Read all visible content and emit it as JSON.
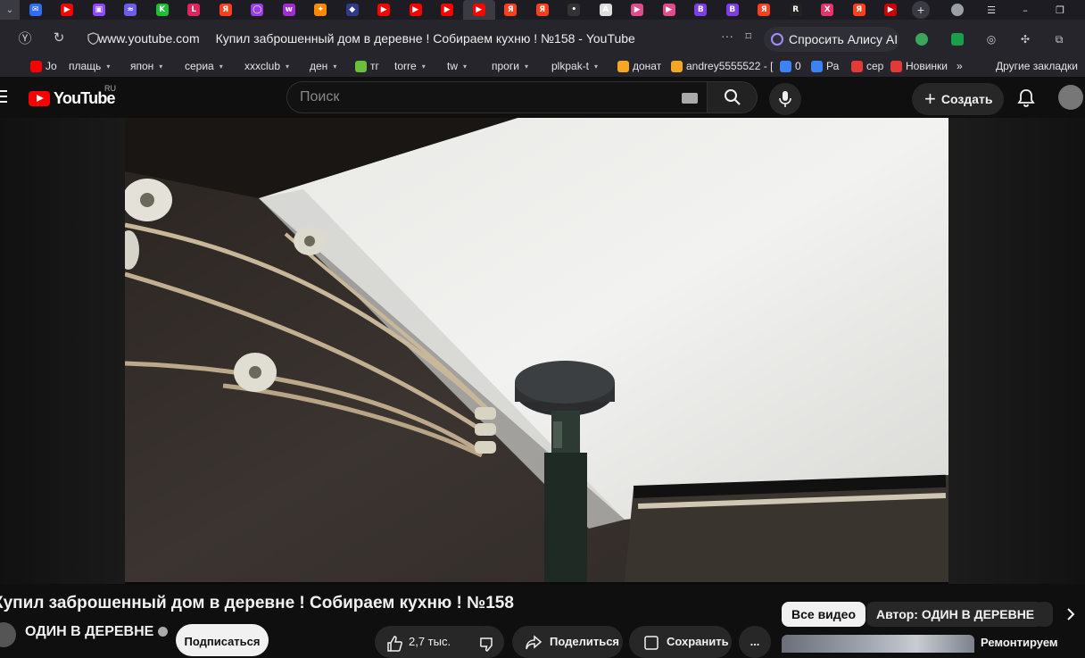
{
  "browser": {
    "tabs": [
      {
        "icon": "mail-icon",
        "color": "#2f6df6",
        "glyph": "✉"
      },
      {
        "icon": "youtube-icon",
        "color": "#ff0000",
        "glyph": "▶"
      },
      {
        "icon": "twitch-icon",
        "color": "#9146ff",
        "glyph": "▣"
      },
      {
        "icon": "generic-site-icon",
        "color": "#6c5ce7",
        "glyph": "≈"
      },
      {
        "icon": "kick-icon",
        "color": "#1dbf30",
        "glyph": "K"
      },
      {
        "icon": "live-icon",
        "color": "#e0245e",
        "glyph": "L"
      },
      {
        "icon": "yandex-icon",
        "color": "#fc3f1d",
        "glyph": "Я"
      },
      {
        "icon": "ring-site-icon",
        "color": "#9b3cf5",
        "glyph": "◯"
      },
      {
        "icon": "wildberries-icon",
        "color": "#a22bd6",
        "glyph": "w"
      },
      {
        "icon": "fire-icon",
        "color": "#ff8a00",
        "glyph": "✦"
      },
      {
        "icon": "dark-site-icon",
        "color": "#2e3b8a",
        "glyph": "◆"
      },
      {
        "icon": "youtube-icon",
        "color": "#ff0000",
        "glyph": "▶"
      },
      {
        "icon": "youtube-icon",
        "color": "#ff0000",
        "glyph": "▶"
      },
      {
        "icon": "youtube-icon",
        "color": "#ff0000",
        "glyph": "▶"
      },
      {
        "icon": "youtube-icon",
        "color": "#ff0000",
        "glyph": "▶",
        "active": true
      },
      {
        "icon": "yandex-icon",
        "color": "#fc3f1d",
        "glyph": "Я"
      },
      {
        "icon": "yandex-icon",
        "color": "#fc3f1d",
        "glyph": "Я"
      },
      {
        "icon": "dots-site-icon",
        "color": "#333333",
        "glyph": "•"
      },
      {
        "icon": "letter-site-icon",
        "color": "#dddddd",
        "glyph": "A"
      },
      {
        "icon": "pink-play-icon",
        "color": "#e14a8d",
        "glyph": "▶"
      },
      {
        "icon": "pink-play-icon",
        "color": "#e14a8d",
        "glyph": "▶"
      },
      {
        "icon": "vk-video-icon",
        "color": "#7b3fe4",
        "glyph": "B"
      },
      {
        "icon": "vk-video-icon",
        "color": "#7b3fe4",
        "glyph": "B"
      },
      {
        "icon": "yandex-icon",
        "color": "#fc3f1d",
        "glyph": "Я"
      },
      {
        "icon": "r-site-icon",
        "color": "#222222",
        "glyph": "R"
      },
      {
        "icon": "x-site-icon",
        "color": "#e8336d",
        "glyph": "X"
      },
      {
        "icon": "yandex-icon",
        "color": "#fc3f1d",
        "glyph": "Я"
      },
      {
        "icon": "red-play-icon",
        "color": "#cc0000",
        "glyph": "▶"
      }
    ],
    "omnibox": {
      "domain": "www.youtube.com",
      "page_title": "Купил заброшенный дом в деревне ! Собираем кухню ! №158 - YouTube"
    },
    "alice_label": "Спросить Алису AI",
    "bookmarks": [
      {
        "label": "Jo",
        "icon": "youtube-icon",
        "color": "#ff0000",
        "chevron": false
      },
      {
        "label": "плащь",
        "chevron": true
      },
      {
        "label": "япон",
        "chevron": true
      },
      {
        "label": "сериа",
        "chevron": true
      },
      {
        "label": "xxxclub",
        "chevron": true
      },
      {
        "label": "ден",
        "chevron": true
      },
      {
        "label": "тг",
        "icon": "bookmark-site-icon",
        "color": "#6bbf3a",
        "chevron": false
      },
      {
        "label": "torre",
        "chevron": true
      },
      {
        "label": "tw",
        "chevron": true
      },
      {
        "label": "проги",
        "chevron": true
      },
      {
        "label": "plkpak-t",
        "chevron": true
      },
      {
        "label": "донат",
        "icon": "donation-icon",
        "color": "#f5a623",
        "chevron": false
      },
      {
        "label": "andrey5555522 - [",
        "icon": "donation-icon",
        "color": "#f5a623",
        "chevron": false
      },
      {
        "label": "0",
        "icon": "counter-icon",
        "color": "#3b82f6",
        "chevron": false
      },
      {
        "label": "Ра",
        "icon": "site-icon",
        "color": "#3b82f6",
        "chevron": false
      },
      {
        "label": "сер",
        "icon": "site-icon",
        "color": "#e53935",
        "chevron": false
      },
      {
        "label": "Новинки",
        "icon": "lf-icon",
        "color": "#e53935",
        "chevron": false
      }
    ],
    "more_bookmarks": "»",
    "other_bookmarks": "Другие закладки"
  },
  "youtube": {
    "region": "RU",
    "logo_text": "YouTube",
    "search_placeholder": "Поиск",
    "create_label": "Создать",
    "video": {
      "title": "Купил заброшенный дом в деревне ! Собираем кухню ! №158",
      "channel": "ОДИН В ДЕРЕВНЕ",
      "subscribe": "Подписаться",
      "likes": "2,7 тыс.",
      "share": "Поделиться",
      "save": "Сохранить",
      "more": "..."
    },
    "chips": {
      "all": "Все видео",
      "author": "Автор: ОДИН В ДЕРЕВНЕ"
    },
    "recommended_title": "Ремонтируем"
  }
}
